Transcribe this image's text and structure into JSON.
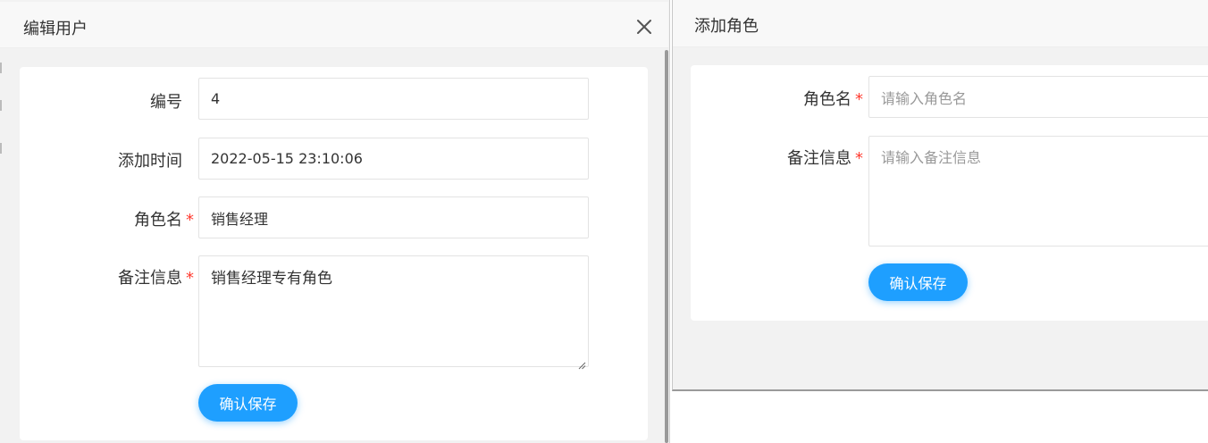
{
  "edit_dialog": {
    "title": "编辑用户",
    "fields": {
      "id": {
        "label": "编号",
        "value": "4"
      },
      "created_at": {
        "label": "添加时间",
        "value": "2022-05-15 23:10:06"
      },
      "role_name": {
        "label": "角色名",
        "required_mark": "*",
        "value": "销售经理"
      },
      "remark": {
        "label": "备注信息",
        "required_mark": "*",
        "value": "销售经理专有角色"
      }
    },
    "submit_label": "确认保存",
    "close_icon": "close-icon"
  },
  "add_dialog": {
    "title": "添加角色",
    "fields": {
      "role_name": {
        "label": "角色名",
        "required_mark": "*",
        "placeholder": "请输入角色名"
      },
      "remark": {
        "label": "备注信息",
        "required_mark": "*",
        "placeholder": "请输入备注信息"
      }
    },
    "submit_label": "确认保存"
  },
  "colors": {
    "primary": "#1e9fff",
    "required": "#ff3b30",
    "dialog_bg": "#f2f2f2",
    "header_bg": "#f8f8f8"
  }
}
